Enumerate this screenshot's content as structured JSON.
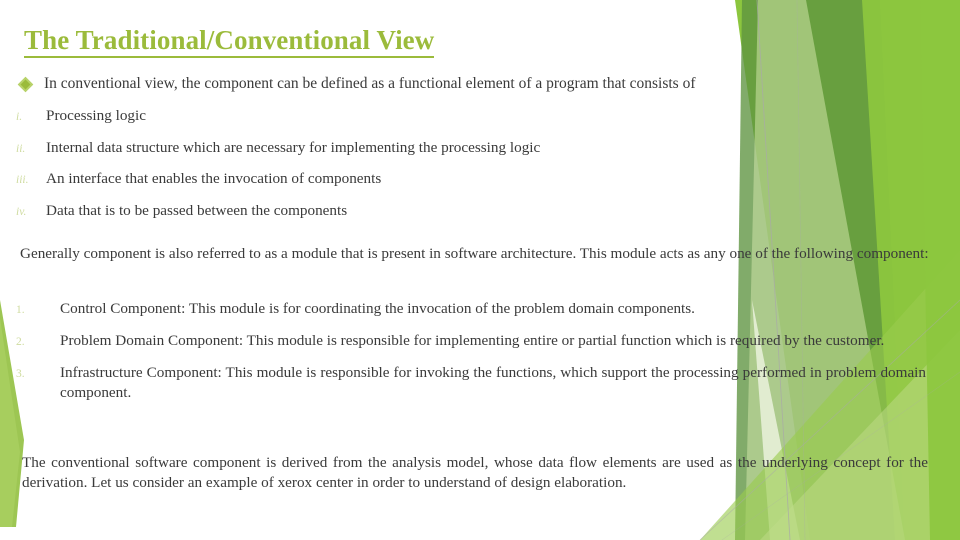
{
  "slide": {
    "title": " The Traditional/Conventional View",
    "title_color": "#9BBB3B",
    "body_text_color": "#3A3A3A",
    "marker_color": "#CFDCA0",
    "background_color": "#FFFFFF"
  },
  "lead": {
    "bullet_icon": "diamond-bullet-icon",
    "text": "In conventional view, the component can be defined as a functional element of a program that consists of"
  },
  "roman_list": [
    {
      "marker": "i.",
      "text": "Processing logic"
    },
    {
      "marker": "ii.",
      "text": "Internal data structure which are necessary for implementing the processing logic"
    },
    {
      "marker": "iii.",
      "text": "An interface that enables the invocation of components"
    },
    {
      "marker": "iv.",
      "text": "Data that is to be passed between the components"
    }
  ],
  "paragraph_generally": "Generally component is also referred to as a module that is present in software architecture. This module acts as any one of the following component:",
  "numbered_list": [
    {
      "marker": "1.",
      "text": "Control Component: This module is for coordinating the invocation of the problem domain components."
    },
    {
      "marker": "2.",
      "text": "Problem Domain Component: This module is responsible for implementing entire or partial function  which is required by the customer."
    },
    {
      "marker": "3.",
      "text": "Infrastructure Component: This module is responsible for invoking the functions, which support the processing performed in problem domain component."
    }
  ],
  "paragraph_closing": "The conventional software component is derived from the analysis model, whose data flow elements are used as the underlying concept for the derivation. Let us consider an example  of xerox center in order to understand of design elaboration.",
  "decoration": {
    "name": "green-angular-shapes",
    "colors": {
      "bright_green": "#8CC63E",
      "mid_green": "#7FB93C",
      "dark_green": "#6AA84F",
      "pale_green": "#DCE9C4",
      "soft_green": "#B9D67E",
      "line_gray": "#A9A9A9"
    }
  }
}
